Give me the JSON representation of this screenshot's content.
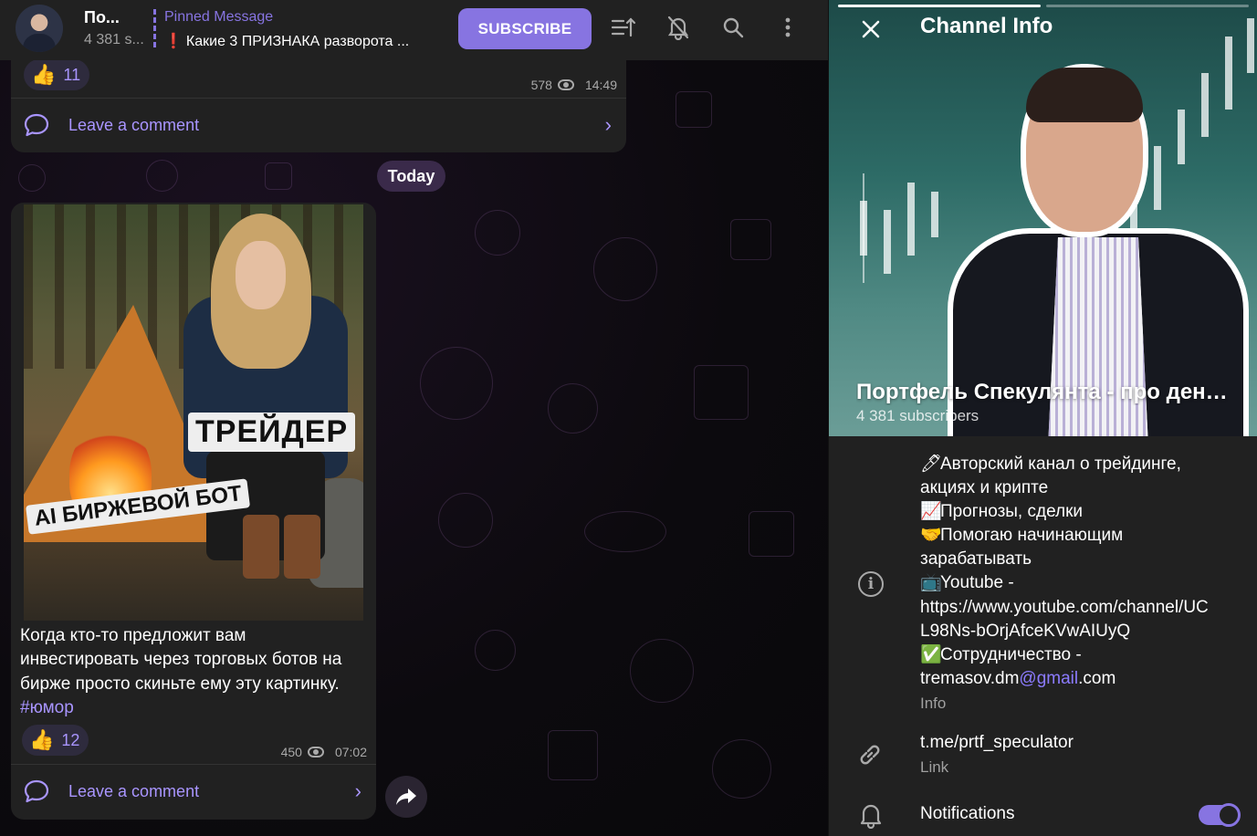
{
  "header": {
    "channel_name": "По...",
    "subscribers_short": "4 381 s...",
    "pinned_title": "Pinned Message",
    "pinned_mark": "❗",
    "pinned_text": "Какие 3 ПРИЗНАКА разворота ...",
    "subscribe_label": "SUBSCRIBE",
    "icons": [
      "filter-icon",
      "mute-bell-icon",
      "search-icon",
      "more-icon"
    ]
  },
  "chat": {
    "prev_message": {
      "reaction_emoji": "👍",
      "reaction_count": "11",
      "views": "578",
      "time": "14:49",
      "comment_label": "Leave a comment"
    },
    "date_divider": "Today",
    "message": {
      "image_label_1": "ТРЕЙДЕР",
      "image_label_2": "AI БИРЖЕВОЙ БОТ",
      "text": "Когда кто-то предложит вам инвестировать через торговых ботов на бирже просто скиньте ему эту картинку. ",
      "hashtag": "#юмор",
      "reaction_emoji": "👍",
      "reaction_count": "12",
      "views": "450",
      "time": "07:02",
      "comment_label": "Leave a comment"
    }
  },
  "panel": {
    "title": "Channel Info",
    "channel_full_name": "Портфель Спекулянта - про деньг...",
    "subscribers": "4 381 subscribers",
    "description_lines": [
      {
        "emoji": "🖊",
        "text": "Авторский канал о трейдинге,"
      },
      {
        "emoji": "",
        "text": "акциях и крипте"
      },
      {
        "emoji": "📈",
        "text": "Прогнозы, сделки"
      },
      {
        "emoji": "🤝",
        "text": "Помогаю начинающим"
      },
      {
        "emoji": "",
        "text": "зарабатывать"
      },
      {
        "emoji": "📺",
        "text": "Youtube -"
      },
      {
        "emoji": "",
        "text": "https://www.youtube.com/channel/UC"
      },
      {
        "emoji": "",
        "text": "L98Ns-bOrjAfceKVwAIUyQ"
      },
      {
        "emoji": "✅",
        "text": "Сотрудничество -"
      }
    ],
    "email_prefix": "tremasov.dm",
    "email_domain": "@gmail",
    "email_suffix": ".com",
    "description_caption": "Info",
    "link": "t.me/prtf_speculator",
    "link_caption": "Link",
    "notifications_label": "Notifications",
    "notifications_enabled": true
  },
  "colors": {
    "accent": "#8774e1",
    "accent_text": "#a995ff",
    "bubble": "#212121",
    "panel": "#212121"
  }
}
